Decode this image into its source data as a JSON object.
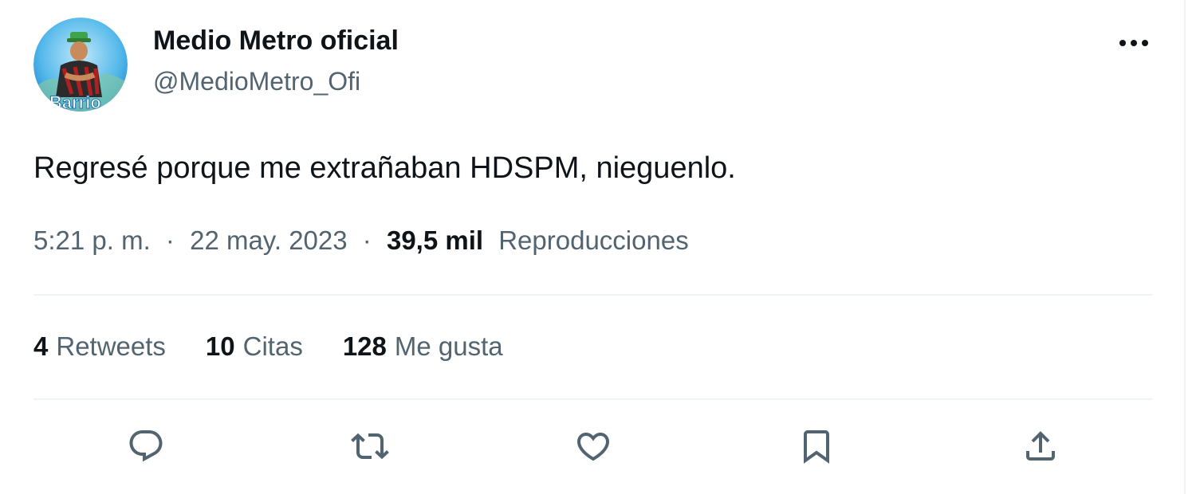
{
  "author": {
    "name": "Medio Metro oficial",
    "handle": "@MedioMetro_Ofi",
    "avatar_icon": "profile-avatar-icon",
    "avatar_text": "Barrio"
  },
  "tweet": {
    "text": "Regresé porque me extrañaban HDSPM, nieguenlo."
  },
  "meta": {
    "time": "5:21 p. m.",
    "separator": "·",
    "date": "22 may. 2023",
    "views_count": "39,5 mil",
    "views_label": "Reproducciones"
  },
  "stats": [
    {
      "count": "4",
      "label": "Retweets"
    },
    {
      "count": "10",
      "label": "Citas"
    },
    {
      "count": "128",
      "label": "Me gusta"
    }
  ],
  "actions": [
    {
      "name": "reply",
      "icon": "reply-icon"
    },
    {
      "name": "retweet",
      "icon": "retweet-icon"
    },
    {
      "name": "like",
      "icon": "heart-icon"
    },
    {
      "name": "bookmark",
      "icon": "bookmark-icon"
    },
    {
      "name": "share",
      "icon": "share-icon"
    }
  ],
  "colors": {
    "text_primary": "#0f1419",
    "text_secondary": "#536471",
    "divider": "#eff3f4"
  }
}
